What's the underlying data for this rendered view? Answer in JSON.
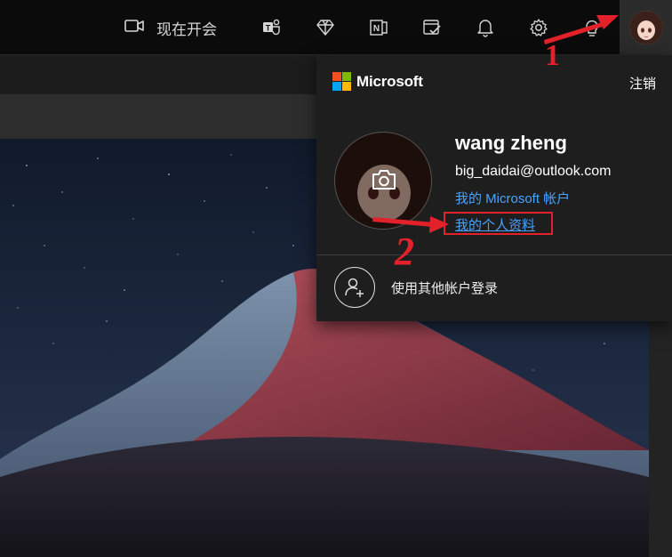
{
  "topbar": {
    "meet_label": "现在开会",
    "icons": [
      "video-camera-icon",
      "teams-icon",
      "diamond-icon",
      "onenote-icon",
      "tasks-icon",
      "bell-icon",
      "gear-icon",
      "lightbulb-icon"
    ]
  },
  "panel": {
    "brand": "Microsoft",
    "signout_label": "注销",
    "user_name": "wang zheng",
    "email": "big_daidai@outlook.com",
    "ms_account_link": "我的 Microsoft 帐户",
    "profile_link": "我的个人资料",
    "other_account_label": "使用其他帐户登录"
  },
  "annotations": {
    "step1": "1",
    "step2": "2",
    "color": "#e3212b"
  },
  "colors": {
    "link": "#4aa3ff",
    "topbar": "#0b0b0b",
    "panel": "#1e1e1e"
  }
}
